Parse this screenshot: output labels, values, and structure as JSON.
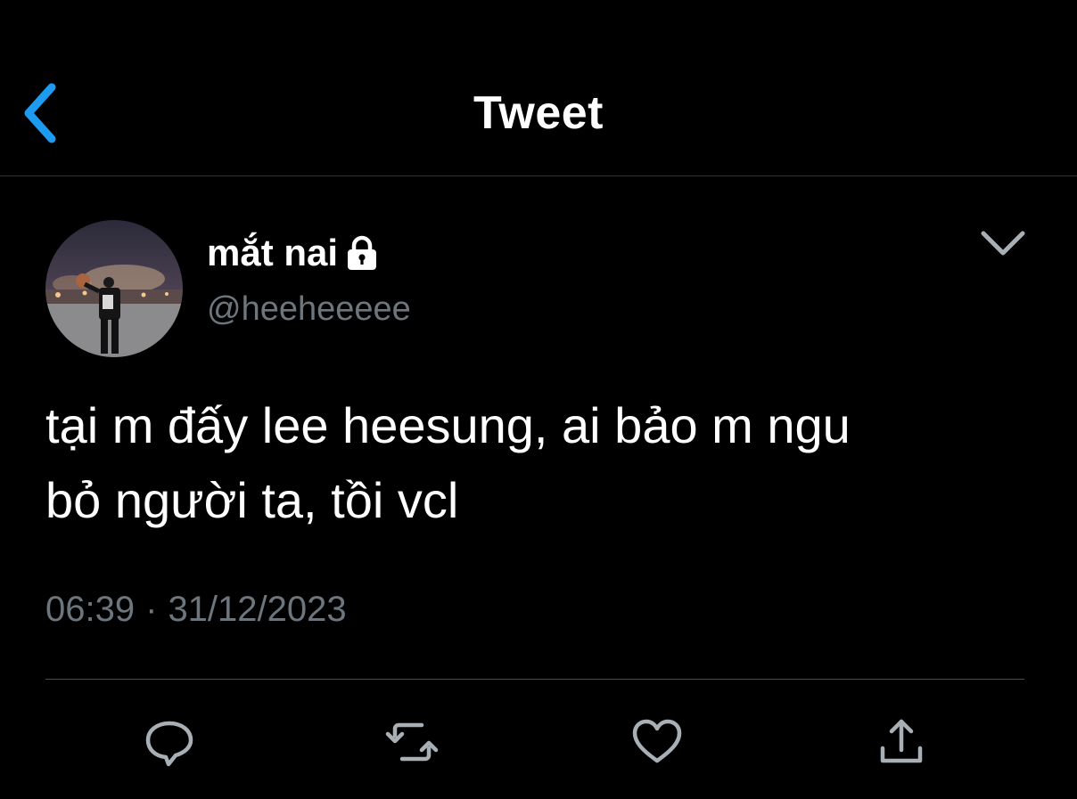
{
  "header": {
    "title": "Tweet",
    "back_icon": "chevron-left-icon"
  },
  "colors": {
    "background": "#000000",
    "accent": "#1d9bf0",
    "text": "#ffffff",
    "secondary_text": "#6e767d",
    "icon": "#a8afb5"
  },
  "tweet": {
    "author": {
      "display_name": "mắt nai",
      "handle": "@heeheeeee",
      "protected_icon": "lock-icon"
    },
    "text_line1": "tại m đấy lee heesung, ai bảo m ngu",
    "text_line2": "bỏ người ta, tồi vcl",
    "time": "06:39",
    "separator": "·",
    "date": "31/12/2023"
  },
  "actions": [
    {
      "name": "reply",
      "icon": "comment-icon"
    },
    {
      "name": "retweet",
      "icon": "retweet-icon"
    },
    {
      "name": "like",
      "icon": "heart-icon"
    },
    {
      "name": "share",
      "icon": "share-icon"
    }
  ]
}
